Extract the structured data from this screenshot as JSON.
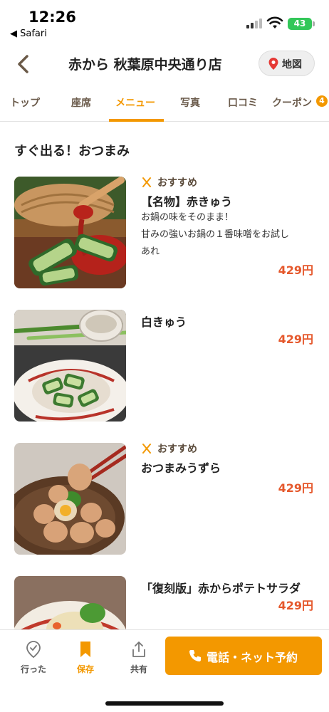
{
  "status_bar": {
    "time": "12:26",
    "back_app": "◀ Safari",
    "battery": "43"
  },
  "header": {
    "title": "赤から 秋葉原中央通り店",
    "map_label": "地図"
  },
  "tabs": [
    {
      "label": "トップ",
      "active": false
    },
    {
      "label": "座席",
      "active": false
    },
    {
      "label": "メニュー",
      "active": true
    },
    {
      "label": "写真",
      "active": false
    },
    {
      "label": "口コミ",
      "active": false
    },
    {
      "label": "クーポン",
      "active": false
    }
  ],
  "coupon_count": "4",
  "section_title": "すぐ出る！おつまみ",
  "items": [
    {
      "recommended": "おすすめ",
      "name": "【名物】赤きゅう",
      "desc1": "お鍋の味をそのまま！",
      "desc2": "甘みの強いお鍋の１番味噌をお試し",
      "desc3": "あれ",
      "price": "429円"
    },
    {
      "name": "白きゅう",
      "price": "429円"
    },
    {
      "recommended": "おすすめ",
      "name": "おつまみうずら",
      "price": "429円"
    },
    {
      "name": "「復刻版」赤からポテトサラダ",
      "price": "429円"
    }
  ],
  "bottom_bar": {
    "visited": "行った",
    "saved": "保存",
    "share": "共有",
    "reserve": "電話・ネット予約"
  },
  "colors": {
    "accent": "#f39800",
    "price": "#e5582c"
  }
}
